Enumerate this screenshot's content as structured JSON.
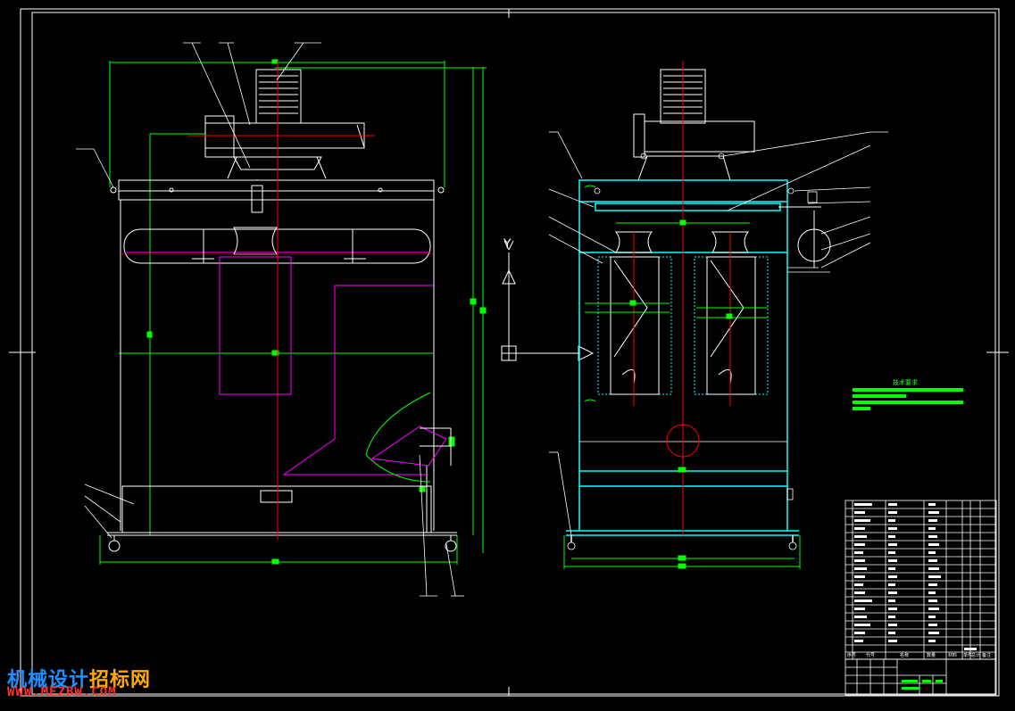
{
  "watermark": {
    "line1_part1": "机械设计",
    "line1_part2": "招标网",
    "line2": "WWW.MEZBW.COM",
    "color1": "#ffaa00",
    "color2": "#1e90ff",
    "color3": "#ff3030"
  },
  "tech_requirements_title": "技术要求",
  "title_block": {
    "header": [
      "序号",
      "代号",
      "名称",
      "数量",
      "材料",
      "单件",
      "总计",
      "备注"
    ]
  },
  "axis_label_y": "Y",
  "colors": {
    "frame": "#ffffff",
    "dimension": "#00ff00",
    "centerline": "#ff0000",
    "section": "#ff00ff",
    "body": "#00ffff",
    "background": "#000000"
  }
}
